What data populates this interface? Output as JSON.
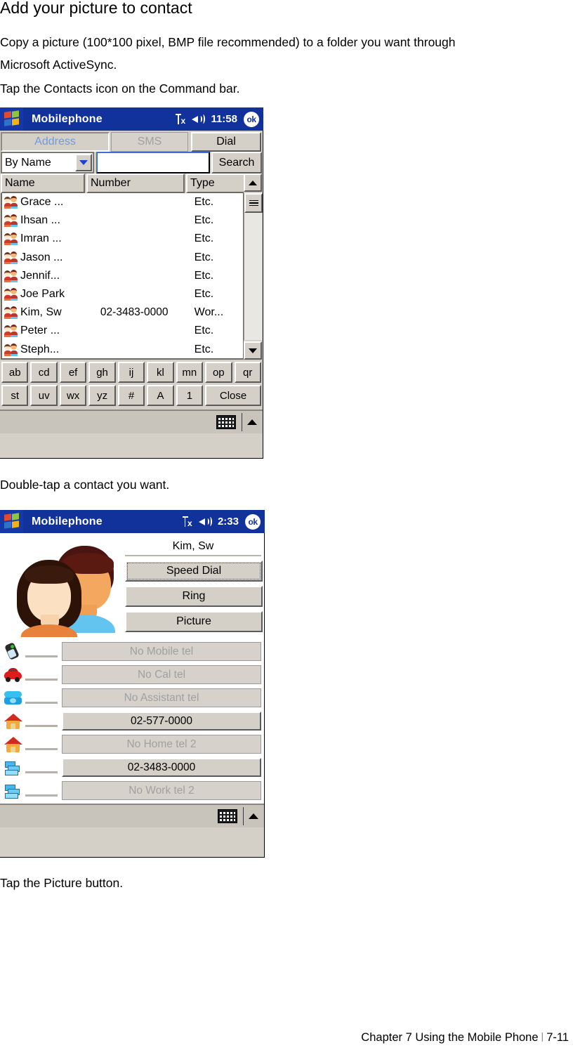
{
  "document": {
    "heading": "Add your picture to contact",
    "para1_line1": "Copy a picture (100*100 pixel, BMP file recommended) to a folder you want through",
    "para1_line2": "Microsoft ActiveSync.",
    "para1_line3": "Tap the Contacts icon on the Command bar.",
    "para2": "Double-tap a contact you want.",
    "para3": "Tap the Picture button.",
    "footer_text": "Chapter 7 Using the Mobile Phone",
    "footer_page": "7-11",
    "footer_separator": "|"
  },
  "screenshot1": {
    "titlebar": {
      "app_title": "Mobilephone",
      "signal_icon": "signal-no-service-icon",
      "speaker_icon": "speaker-icon",
      "clock": "11:58",
      "ok_label": "ok"
    },
    "tabs": [
      {
        "label": "Address",
        "state": "active"
      },
      {
        "label": "SMS",
        "state": "disabled"
      },
      {
        "label": "Dial",
        "state": "normal"
      }
    ],
    "search": {
      "filter_value": "By Name",
      "input_value": "",
      "input_placeholder": "",
      "button_label": "Search"
    },
    "list": {
      "columns": [
        "Name",
        "Number",
        "Type"
      ],
      "rows": [
        {
          "name": "Grace ...",
          "number": "",
          "type": "Etc."
        },
        {
          "name": "Ihsan ...",
          "number": "",
          "type": "Etc."
        },
        {
          "name": "Imran ...",
          "number": "",
          "type": "Etc."
        },
        {
          "name": "Jason ...",
          "number": "",
          "type": "Etc."
        },
        {
          "name": "Jennif...",
          "number": "",
          "type": "Etc."
        },
        {
          "name": "Joe Park",
          "number": "",
          "type": "Etc."
        },
        {
          "name": "Kim, Sw",
          "number": "02-3483-0000",
          "type": "Wor..."
        },
        {
          "name": "Peter ...",
          "number": "",
          "type": "Etc."
        },
        {
          "name": "Steph...",
          "number": "",
          "type": "Etc."
        }
      ]
    },
    "keypad": {
      "row1": [
        "ab",
        "cd",
        "ef",
        "gh",
        "ij",
        "kl",
        "mn",
        "op",
        "qr"
      ],
      "row2": [
        "st",
        "uv",
        "wx",
        "yz",
        "#",
        "A",
        "1",
        "Close"
      ]
    },
    "commandbar": {
      "keyboard_icon": "keyboard-icon",
      "expander_icon": "caret-up-icon"
    }
  },
  "screenshot2": {
    "titlebar": {
      "app_title": "Mobilephone",
      "signal_icon": "signal-no-service-icon",
      "speaker_icon": "speaker-icon",
      "clock": "2:33",
      "ok_label": "ok"
    },
    "contact": {
      "avatar_icon": "two-people-avatar-icon",
      "name": "Kim, Sw",
      "actions": [
        {
          "label": "Speed Dial",
          "focused": true
        },
        {
          "label": "Ring",
          "focused": false
        },
        {
          "label": "Picture",
          "focused": false
        }
      ]
    },
    "tel_rows": [
      {
        "icon": "mobile-phone-icon",
        "label": "No Mobile tel",
        "state": "empty"
      },
      {
        "icon": "car-icon",
        "label": "No Cal tel",
        "state": "empty"
      },
      {
        "icon": "telephone-icon",
        "label": "No Assistant tel",
        "state": "empty"
      },
      {
        "icon": "home-icon",
        "label": "02-577-0000",
        "state": "filled"
      },
      {
        "icon": "home-icon",
        "label": "No Home tel 2",
        "state": "empty"
      },
      {
        "icon": "work-icon",
        "label": "02-3483-0000",
        "state": "filled"
      },
      {
        "icon": "work-icon",
        "label": "No Work tel 2",
        "state": "empty"
      }
    ],
    "commandbar": {
      "keyboard_icon": "keyboard-icon",
      "expander_icon": "caret-up-icon"
    }
  },
  "colors": {
    "titlebar_blue": "#12329b",
    "chrome_gray": "#d4d0c8",
    "active_tab_text": "#6f9adf",
    "disabled_text": "#a0a0a0"
  }
}
